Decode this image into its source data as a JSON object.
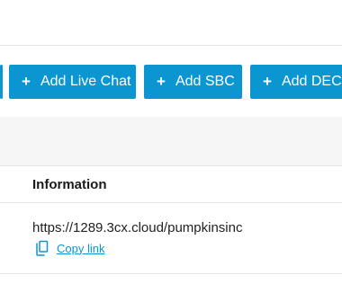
{
  "toolbar": {
    "buttons": [
      {
        "icon": "plus-icon",
        "label": "Add Live Chat"
      },
      {
        "icon": "plus-icon",
        "label": "Add SBC"
      },
      {
        "icon": "plus-icon",
        "label": "Add DECT"
      }
    ]
  },
  "table": {
    "column_header": "Information",
    "rows": [
      {
        "url": "https://1289.3cx.cloud/pumpkinsinc",
        "copy_label": "Copy link",
        "copy_icon": "copy-icon"
      }
    ]
  },
  "colors": {
    "accent": "#0b96d1",
    "link": "#0b96d1",
    "band": "#f6f6f6"
  }
}
